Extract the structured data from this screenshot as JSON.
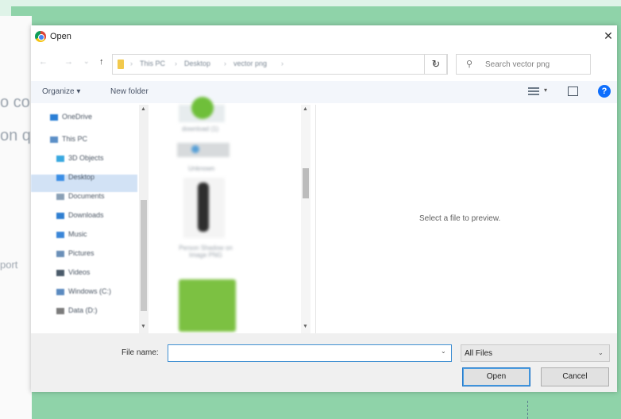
{
  "dialog": {
    "title": "Open",
    "close_glyph": "✕"
  },
  "nav": {
    "back": "←",
    "forward": "→",
    "dropdown": "⌄",
    "up": "↑",
    "breadcrumbs": [
      "This PC",
      "Desktop",
      "vector png"
    ],
    "refresh_glyph": "↻",
    "address_chev": "⌄"
  },
  "search": {
    "placeholder": "Search vector png",
    "icon": "⚲"
  },
  "toolbar": {
    "organize": "Organize ▾",
    "new_folder": "New folder",
    "view_chev": "▾",
    "help": "?"
  },
  "navpane": {
    "items": [
      {
        "label": "OneDrive",
        "icon_color": "#2b7fd6"
      },
      {
        "label": "This PC",
        "icon_color": "#5b8fc7"
      },
      {
        "label": "3D Objects",
        "icon_color": "#39a8e0"
      },
      {
        "label": "Desktop",
        "icon_color": "#3a8ee6"
      },
      {
        "label": "Documents",
        "icon_color": "#8aa0b6"
      },
      {
        "label": "Downloads",
        "icon_color": "#2f7fd1"
      },
      {
        "label": "Music",
        "icon_color": "#3a86d8"
      },
      {
        "label": "Pictures",
        "icon_color": "#6a8fb8"
      },
      {
        "label": "Videos",
        "icon_color": "#4a5a6a"
      },
      {
        "label": "Windows (C:)",
        "icon_color": "#5a8ac0"
      },
      {
        "label": "Data (D:)",
        "icon_color": "#7b7b7b"
      }
    ],
    "selected": "Desktop"
  },
  "files": {
    "labels": [
      "download (1)",
      "Unknown",
      "Person Shadow on Image PNG"
    ]
  },
  "preview": {
    "text": "Select a file to preview."
  },
  "bottom": {
    "file_name_label": "File name:",
    "file_name_value": "",
    "file_type": "All Files",
    "open_label": "Open",
    "cancel_label": "Cancel",
    "chev": "⌄"
  }
}
